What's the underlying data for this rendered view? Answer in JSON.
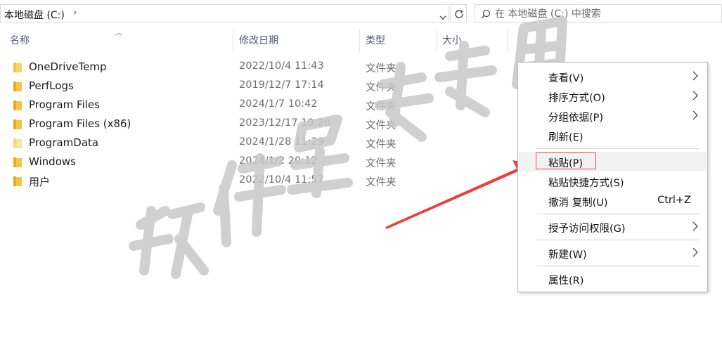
{
  "address": {
    "path": "本地磁盘 (C:)"
  },
  "search": {
    "placeholder": "在 本地磁盘 (C:) 中搜索"
  },
  "columns": {
    "name": "名称",
    "date": "修改日期",
    "type": "类型",
    "size": "大小"
  },
  "files": [
    {
      "name": "OneDriveTemp",
      "date": "2022/10/4 11:43",
      "type": "文件夹"
    },
    {
      "name": "PerfLogs",
      "date": "2019/12/7 17:14",
      "type": "文件夹"
    },
    {
      "name": "Program Files",
      "date": "2024/1/7 10:42",
      "type": "文件夹"
    },
    {
      "name": "Program Files (x86)",
      "date": "2023/12/17 10:28",
      "type": "文件夹"
    },
    {
      "name": "ProgramData",
      "date": "2024/1/28 11:29",
      "type": "文件夹"
    },
    {
      "name": "Windows",
      "date": "2024/1/2 20:12",
      "type": "文件夹"
    },
    {
      "name": "用户",
      "date": "2022/10/4 11:57",
      "type": "文件夹"
    }
  ],
  "menu": {
    "view": "查看(V)",
    "sort": "排序方式(O)",
    "group": "分组依据(P)",
    "refresh": "刷新(E)",
    "paste": "粘贴(P)",
    "paste_shortcut": "粘贴快捷方式(S)",
    "undo": "撤消 复制(U)",
    "undo_shortcut": "Ctrl+Z",
    "grant_access": "授予访问权限(G)",
    "new": "新建(W)",
    "properties": "属性(R)"
  },
  "watermark": {
    "text": "软件管家专用"
  },
  "colors": {
    "folder": "#f6c443",
    "highlight_box": "#e24c4c",
    "arrow": "#e8423f"
  },
  "icons": {
    "address_chevron": "chevron-right-icon",
    "dropdown": "chevron-down-icon",
    "refresh": "refresh-icon",
    "search": "search-icon",
    "folder": "folder-icon",
    "submenu": "chevron-right-icon"
  }
}
